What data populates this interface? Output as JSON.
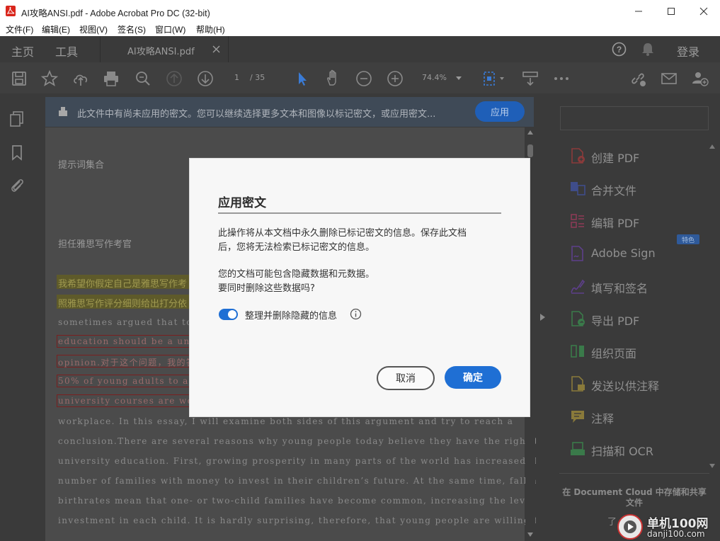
{
  "window": {
    "title": "AI攻略ANSI.pdf - Adobe Acrobat Pro DC (32-bit)"
  },
  "menu": [
    "文件(F)",
    "编辑(E)",
    "视图(V)",
    "签名(S)",
    "窗口(W)",
    "帮助(H)"
  ],
  "tabs": {
    "home": "主页",
    "tools": "工具",
    "doc": "AI攻略ANSI.pdf",
    "login": "登录"
  },
  "toolbar": {
    "page_current": "1",
    "page_total": "/ 35",
    "zoom": "74.4%"
  },
  "notice": {
    "text": "此文件中有尚未应用的密文。您可以继续选择更多文本和图像以标记密文，或应用密文...",
    "apply": "应用"
  },
  "document": {
    "heading1": "提示词集合",
    "heading2": "担任雅思写作考官",
    "lines": [
      "我希望你假定自己是雅思写作考",
      "照雅思写作评分细则给出打分依",
      "sometimes argued that too ma",
      "education should be a univ",
      "opinion.对于这个问题，我的答",
      "50% of young adults to atte",
      "university courses are wort",
      "workplace. In this essay, I will examine both sides of this argument and try to reach a",
      "conclusion.There are several reasons why young people today believe they have the right to a",
      "university education. First, growing prosperity in many parts of the world has increased the",
      "number of families with money to invest in their children’s future. At the same time, falling",
      "birthrates mean that one- or two-child families have become common, increasing the level of",
      "investment in each child. It is hardly surprising, therefore, that young people are willing to"
    ]
  },
  "right_panel": {
    "items": [
      {
        "label": "创建 PDF",
        "icon": "create-pdf-icon",
        "color": "#c84040"
      },
      {
        "label": "合并文件",
        "icon": "combine-files-icon",
        "color": "#4b5fc8"
      },
      {
        "label": "编辑 PDF",
        "icon": "edit-pdf-icon",
        "color": "#c84070"
      },
      {
        "label": "Adobe Sign",
        "icon": "adobe-sign-icon",
        "color": "#7a4fc0"
      },
      {
        "label": "填写和签名",
        "icon": "fill-sign-icon",
        "color": "#7a4fc0"
      },
      {
        "label": "导出 PDF",
        "icon": "export-pdf-icon",
        "color": "#3c9a55"
      },
      {
        "label": "组织页面",
        "icon": "organize-pages-icon",
        "color": "#3c9a55"
      },
      {
        "label": "发送以供注释",
        "icon": "send-comment-icon",
        "color": "#c8a83c"
      },
      {
        "label": "注释",
        "icon": "comment-icon",
        "color": "#c8a83c"
      },
      {
        "label": "扫描和 OCR",
        "icon": "scan-ocr-icon",
        "color": "#3c9a55"
      }
    ],
    "badge": "特色",
    "cloud_text": "在 Document Cloud 中存储和共享文件",
    "cloud_link": "了"
  },
  "dialog": {
    "title": "应用密文",
    "p1a": "此操作将从本文档中永久删除已标记密文的信息。保存此文档",
    "p1b": "后，您将无法检索已标记密文的信息。",
    "p2a": "您的文档可能包含隐藏数据和元数据。",
    "p2b": "要同时删除这些数据吗?",
    "toggle_label": "整理并删除隐藏的信息",
    "cancel": "取消",
    "ok": "确定"
  },
  "watermark": {
    "cn": "单机100网",
    "url": "danji100.com"
  }
}
